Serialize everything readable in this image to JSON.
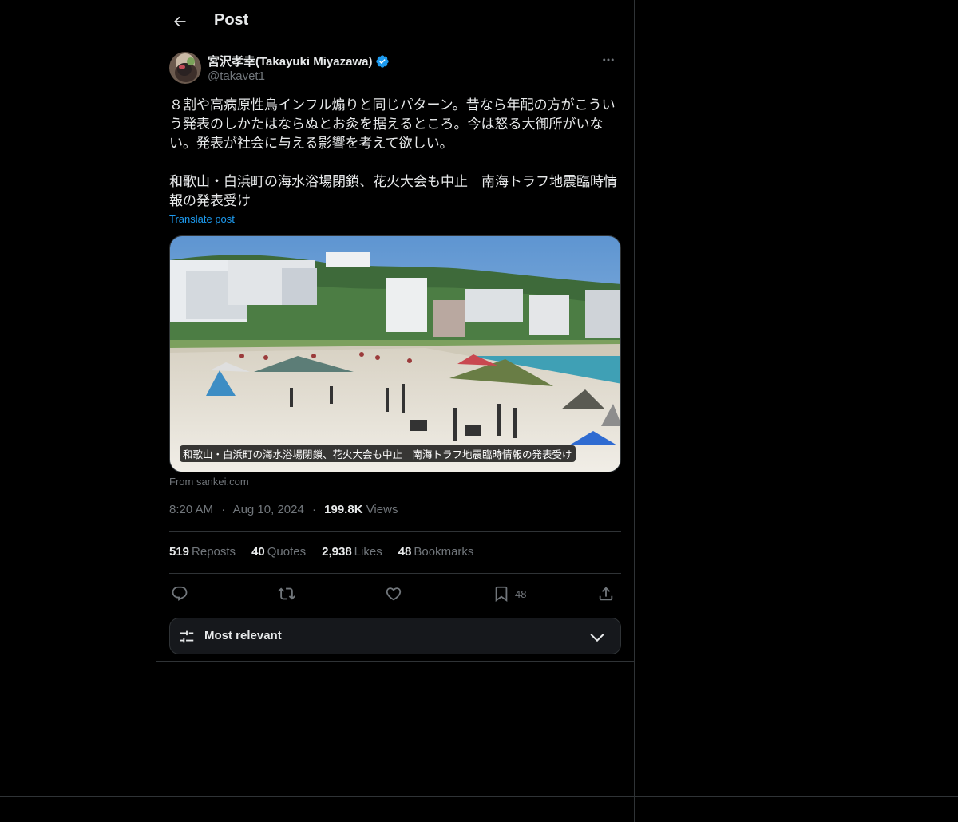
{
  "header": {
    "title": "Post",
    "back_icon": "arrow-left-icon"
  },
  "author": {
    "display_name": "宮沢孝幸(Takayuki Miyazawa)",
    "handle": "@takavet1",
    "verified": true,
    "verified_color": "#1d9bf0"
  },
  "post": {
    "text": "８割や高病原性鳥インフル煽りと同じパターン。昔なら年配の方がこういう発表のしかたはならぬとお灸を据えるところ。今は怒る大御所がいない。発表が社会に与える影響を考えて欲しい。\n\n和歌山・白浜町の海水浴場閉鎖、花火大会も中止　南海トラフ地震臨時情報の発表受け",
    "translate_label": "Translate post"
  },
  "card": {
    "caption": "和歌山・白浜町の海水浴場閉鎖、花火大会も中止　南海トラフ地震臨時情報の発表受け",
    "source": "From sankei.com"
  },
  "meta": {
    "time": "8:20 AM",
    "sep1": "·",
    "date": "Aug 10, 2024",
    "sep2": "·",
    "views_count": "199.8K",
    "views_label": "Views"
  },
  "stats": {
    "reposts_count": "519",
    "reposts_label": "Reposts",
    "quotes_count": "40",
    "quotes_label": "Quotes",
    "likes_count": "2,938",
    "likes_label": "Likes",
    "bookmarks_count": "48",
    "bookmarks_label": "Bookmarks"
  },
  "actions": {
    "reply_icon": "reply-icon",
    "repost_icon": "repost-icon",
    "like_icon": "heart-icon",
    "bookmark_icon": "bookmark-icon",
    "bookmark_count": "48",
    "share_icon": "share-icon"
  },
  "sort": {
    "label": "Most relevant",
    "icon": "sliders-icon",
    "chevron": "chevron-down-icon"
  },
  "colors": {
    "accent": "#1d9bf0",
    "text": "#e7e9ea",
    "muted": "#71767b",
    "border": "#2f3336"
  }
}
